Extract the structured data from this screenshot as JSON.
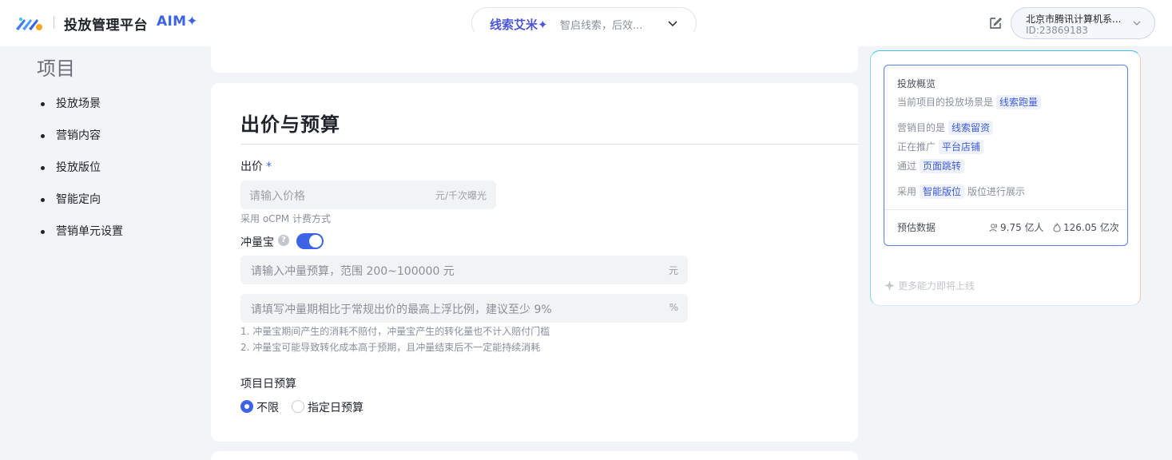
{
  "header": {
    "brand": "投放管理平台",
    "brand_suffix": "AIM✦",
    "assistant": {
      "name": "线索艾米✦",
      "hint": "智启线索，后效..."
    },
    "account": {
      "name": "北京市腾讯计算机系...",
      "id": "ID:23869183"
    }
  },
  "nav": {
    "title": "项目",
    "items": [
      {
        "label": "投放场景"
      },
      {
        "label": "营销内容"
      },
      {
        "label": "投放版位"
      },
      {
        "label": "智能定向"
      },
      {
        "label": "营销单元设置"
      }
    ]
  },
  "bid_section": {
    "title": "出价与预算",
    "bid_label": "出价",
    "required_mark": "*",
    "bid_placeholder": "请输入价格",
    "bid_unit": "元/千次曝光",
    "bid_hint": "采用 oCPM 计费方式",
    "boost_label": "冲量宝",
    "help_mark": "?",
    "boost_enabled": true,
    "budget_placeholder": "请输入冲量预算，范围 200~100000 元",
    "budget_unit": "元",
    "ratio_placeholder": "请填写冲量期相比于常规出价的最高上浮比例，建议至少 9%",
    "ratio_unit": "%",
    "notes": [
      "1. 冲量宝期间产生的消耗不赔付，冲量宝产生的转化量也不计入赔付门槛",
      "2. 冲量宝可能导致转化成本高于预期，且冲量结束后不一定能持续消耗"
    ],
    "daily_label": "项目日预算",
    "daily_options": [
      {
        "label": "不限",
        "checked": true
      },
      {
        "label": "指定日预算",
        "checked": false
      }
    ]
  },
  "overview": {
    "title": "投放概览",
    "scene_prefix": "当前项目的投放场景是",
    "scene": "线索跑量",
    "goal_prefix": "营销目的是",
    "goal": "线索留资",
    "promote_prefix": "正在推广",
    "promote": "平台店铺",
    "via_prefix": "通过",
    "via": "页面跳转",
    "adopt_prefix": "采用",
    "placement": "智能版位",
    "adopt_suffix": "版位进行展示",
    "estimate_label": "预估数据",
    "reach": "9.75 亿人",
    "impressions": "126.05 亿次",
    "more": "更多能力即将上线"
  },
  "colors": {
    "accent": "#3d63e6",
    "assistant": "#4b56d6"
  }
}
